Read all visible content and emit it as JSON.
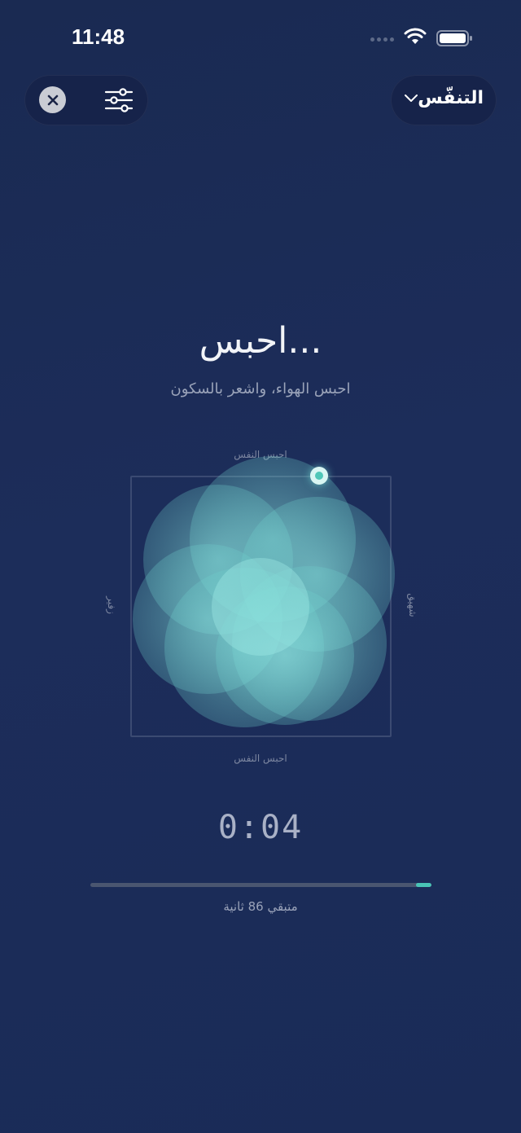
{
  "status_bar": {
    "time": "11:48"
  },
  "header": {
    "mode_label": "التنفّس",
    "close_icon": "close-icon",
    "settings_icon": "sliders-icon",
    "chevron_icon": "chevron-down-icon"
  },
  "main": {
    "title": "احبس...",
    "subtitle": "احبس الهواء، واشعر بالسكون"
  },
  "breath_box": {
    "top_label": "احبس النفس",
    "bottom_label": "احبس النفس",
    "left_label": "زفير",
    "right_label": "شهيق"
  },
  "session": {
    "timer": "0:04",
    "progress_fraction": 0.045,
    "remaining_text": "متبقي 86 ثانية"
  },
  "colors": {
    "accent": "#49c4b6",
    "background": "#1c2d5a"
  }
}
